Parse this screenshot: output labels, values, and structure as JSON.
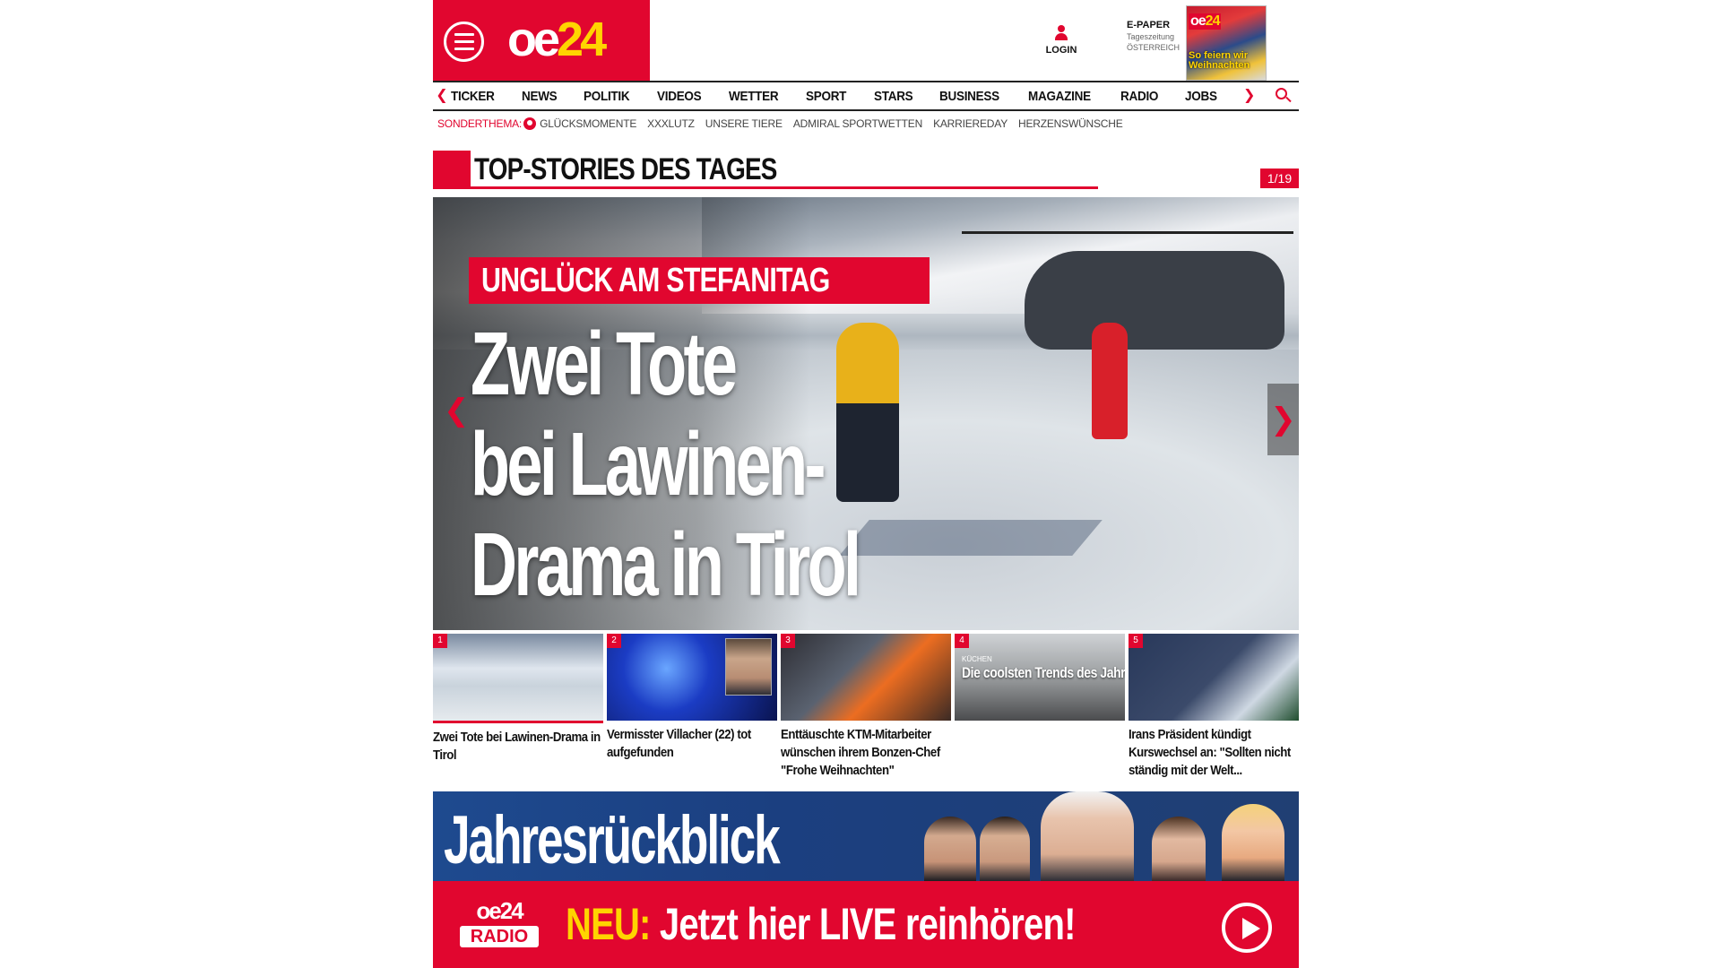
{
  "brand": {
    "logo_main": "oe",
    "logo_num": "24",
    "accent": "#e1062f",
    "yellow": "#ffd400"
  },
  "header": {
    "login_label": "LOGIN",
    "epaper_title": "E-PAPER",
    "epaper_sub1": "Tageszeitung",
    "epaper_sub2": "ÖSTERREICH",
    "cover_logo_main": "oe",
    "cover_logo_num": "24",
    "cover_headline": "So feiern wir Weihnachten"
  },
  "nav": {
    "items": [
      "TICKER",
      "NEWS",
      "POLITIK",
      "VIDEOS",
      "WETTER",
      "SPORT",
      "STARS",
      "BUSINESS",
      "MAGAZINE",
      "RADIO",
      "JOBS"
    ]
  },
  "special": {
    "label": "SONDERTHEMA:",
    "items": [
      "GLÜCKSMOMENTE",
      "XXXLUTZ",
      "UNSERE TIERE",
      "ADMIRAL SPORTWETTEN",
      "KARRIEREDAY",
      "HERZENSWÜNSCHE"
    ]
  },
  "section": {
    "title": "TOP-STORIES DES TAGES",
    "counter": "1/19"
  },
  "hero": {
    "kicker": "UNGLÜCK AM STEFANITAG",
    "headline_lines": [
      "Zwei Tote",
      "bei Lawinen-",
      "Drama in Tirol"
    ]
  },
  "thumbs": [
    {
      "num": "1",
      "title": "Zwei Tote bei Lawinen-Drama in Tirol"
    },
    {
      "num": "2",
      "title": "Vermisster Villacher (22) tot aufgefunden"
    },
    {
      "num": "3",
      "title": "Enttäuschte KTM-Mitarbeiter wünschen ihrem Bonzen-Chef \"Frohe Weihnachten\""
    },
    {
      "num": "4",
      "title": "",
      "overlay_small": "KÜCHEN",
      "overlay": "Die coolsten Trends des Jahres"
    },
    {
      "num": "5",
      "title": "Irans Präsident kündigt Kurswechsel an: \"Sollten nicht ständig mit der Welt..."
    }
  ],
  "banner": {
    "title": "Jahresrückblick",
    "radio_logo_main": "oe24",
    "radio_logo_sub": "RADIO",
    "cta_neu": "NEU:",
    "cta_text": "Jetzt hier LIVE reinhören!"
  }
}
